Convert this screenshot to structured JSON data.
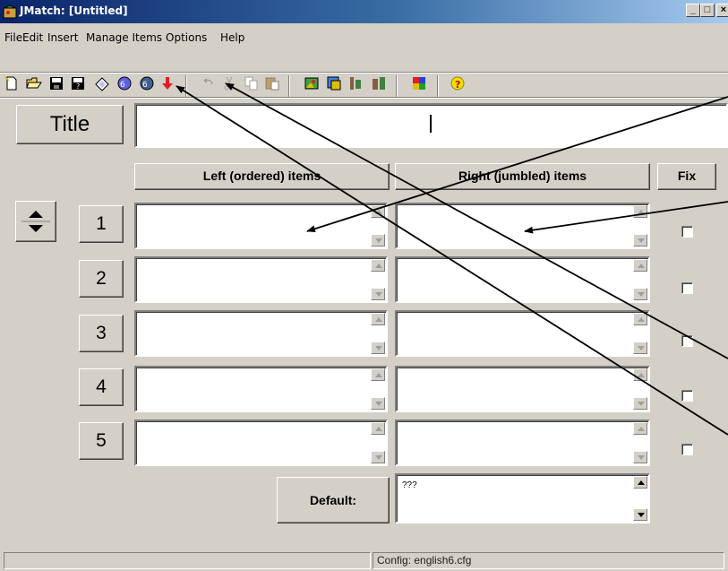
{
  "window": {
    "title": "JMatch: [Untitled]",
    "buttons": {
      "minimize": "_",
      "maximize": "□",
      "close": "×"
    }
  },
  "menu": {
    "file": "File",
    "edit": "Edit",
    "insert": "Insert",
    "manage_items": "Manage Items",
    "options": "Options",
    "help": "Help"
  },
  "toolbar": {
    "icons": [
      "new-file-icon",
      "open-folder-icon",
      "save-icon",
      "save-as-icon",
      "clear-icon",
      "create-web-page-icon",
      "create-drag-drop-page-icon",
      "export-icon",
      "undo-icon",
      "cut-icon",
      "copy-icon",
      "paste-icon",
      "add-picture-icon",
      "add-link-icon",
      "insert-html-icon",
      "insert-media-icon",
      "config-icon",
      "help-icon"
    ]
  },
  "form": {
    "title_label": "Title",
    "title_value": "",
    "left_header": "Left (ordered) items",
    "right_header": "Right (jumbled) items",
    "fix_header": "Fix",
    "rows": [
      {
        "num": "1",
        "left": "",
        "right": "",
        "fixed": false
      },
      {
        "num": "2",
        "left": "",
        "right": "",
        "fixed": false
      },
      {
        "num": "3",
        "left": "",
        "right": "",
        "fixed": false
      },
      {
        "num": "4",
        "left": "",
        "right": "",
        "fixed": false
      },
      {
        "num": "5",
        "left": "",
        "right": "",
        "fixed": false
      }
    ],
    "default_label": "Default:",
    "default_value": "???"
  },
  "statusbar": {
    "left": "",
    "config": "Config: english6.cfg"
  },
  "colors": {
    "titlebar_start": "#0a246a",
    "titlebar_end": "#a6caf0",
    "face": "#d4d0c8"
  }
}
